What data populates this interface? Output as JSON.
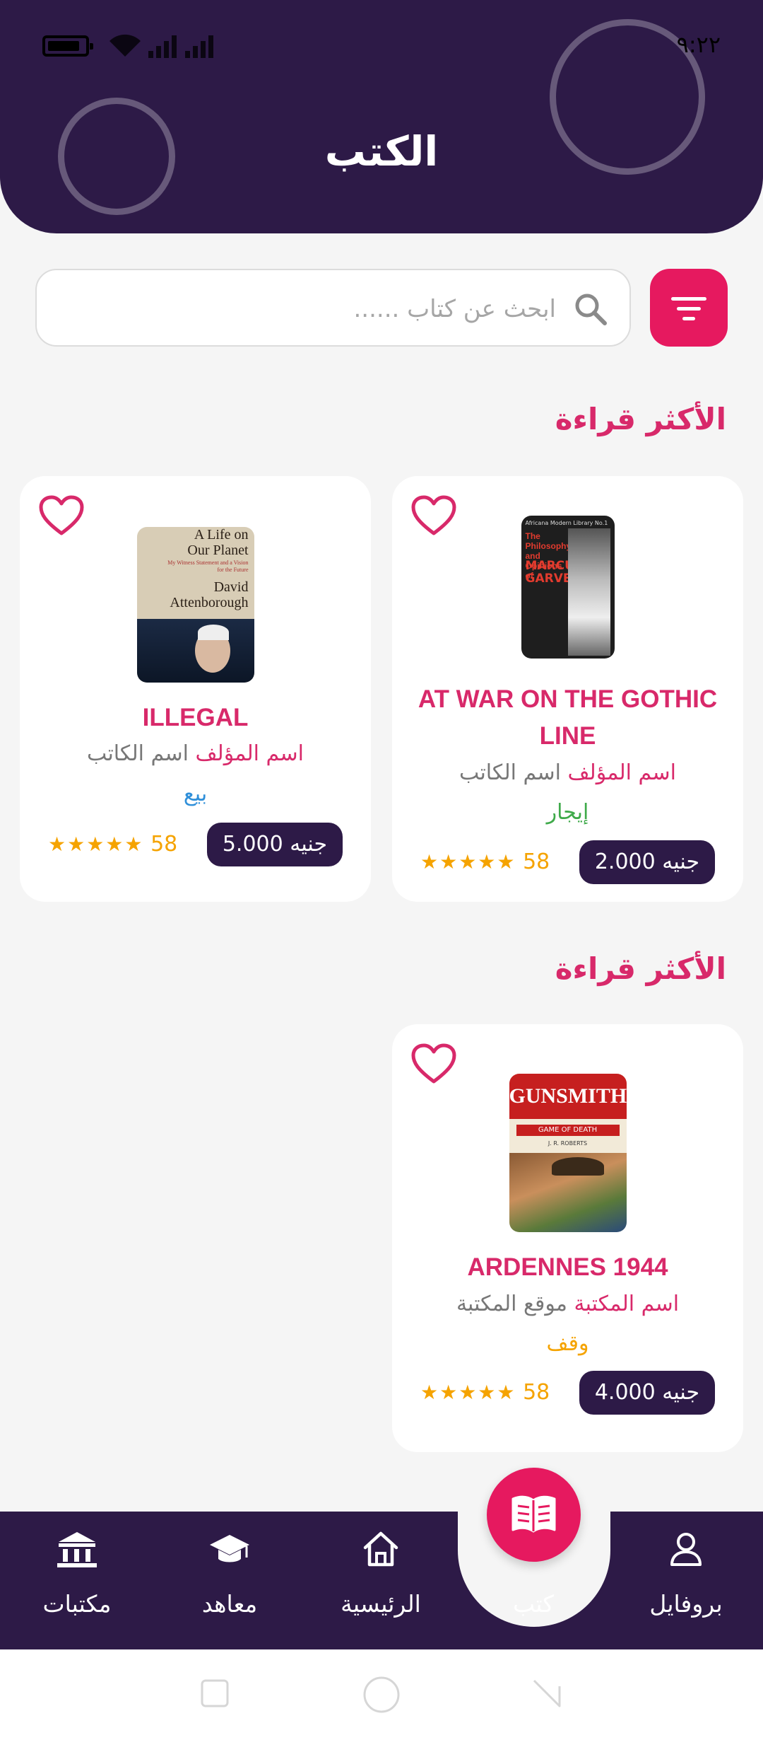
{
  "status_bar": {
    "time": "٩:٢٢"
  },
  "header": {
    "title": "الكتب"
  },
  "search": {
    "placeholder": "ابحث عن كتاب ......"
  },
  "sections": [
    {
      "title": "الأكثر قراءة",
      "books": [
        {
          "title": "AT WAR ON THE GOTHIC LINE",
          "label_primary": "اسم المؤلف",
          "label_secondary": "اسم الكاتب",
          "deal_type": "إيجار",
          "price": "جنيه 2.000",
          "rating_count": "58",
          "stars": "★★★★★",
          "cover": {
            "text_top": "Africana Modern Library No.1",
            "text_main": "The Philosophy and Opinions of",
            "text_name": "MARCUS GARVEY"
          }
        },
        {
          "title": "ILLEGAL",
          "label_primary": "اسم المؤلف",
          "label_secondary": "اسم الكاتب",
          "deal_type": "بيع",
          "price": "جنيه 5.000",
          "rating_count": "58",
          "stars": "★★★★★",
          "cover": {
            "line1": "A Life on",
            "line2": "Our Planet",
            "line3": "My Witness Statement and a Vision for the Future",
            "line4": "David",
            "line5": "Attenborough"
          }
        }
      ]
    },
    {
      "title": "الأكثر قراءة",
      "books": [
        {
          "title": "ARDENNES 1944",
          "label_primary": "اسم المكتبة",
          "label_secondary": "موقع المكتبة",
          "deal_type": "وقف",
          "price": "جنيه 4.000",
          "rating_count": "58",
          "stars": "★★★★★",
          "cover": {
            "brand": "GUNSMITH",
            "subtitle": "GAME OF DEATH",
            "author": "J. R. ROBERTS"
          }
        }
      ]
    }
  ],
  "nav": {
    "profile": "بروفايل",
    "books": "كتب",
    "home": "الرئيسية",
    "institutes": "معاهد",
    "libraries": "مكتبات"
  },
  "colors": {
    "primary": "#2d1a47",
    "accent": "#e6195f",
    "title_pink": "#d8296a",
    "rent_green": "#3faa4a",
    "sale_blue": "#2f8fd9",
    "waqf_orange": "#f5a300",
    "star": "#f5a300"
  }
}
